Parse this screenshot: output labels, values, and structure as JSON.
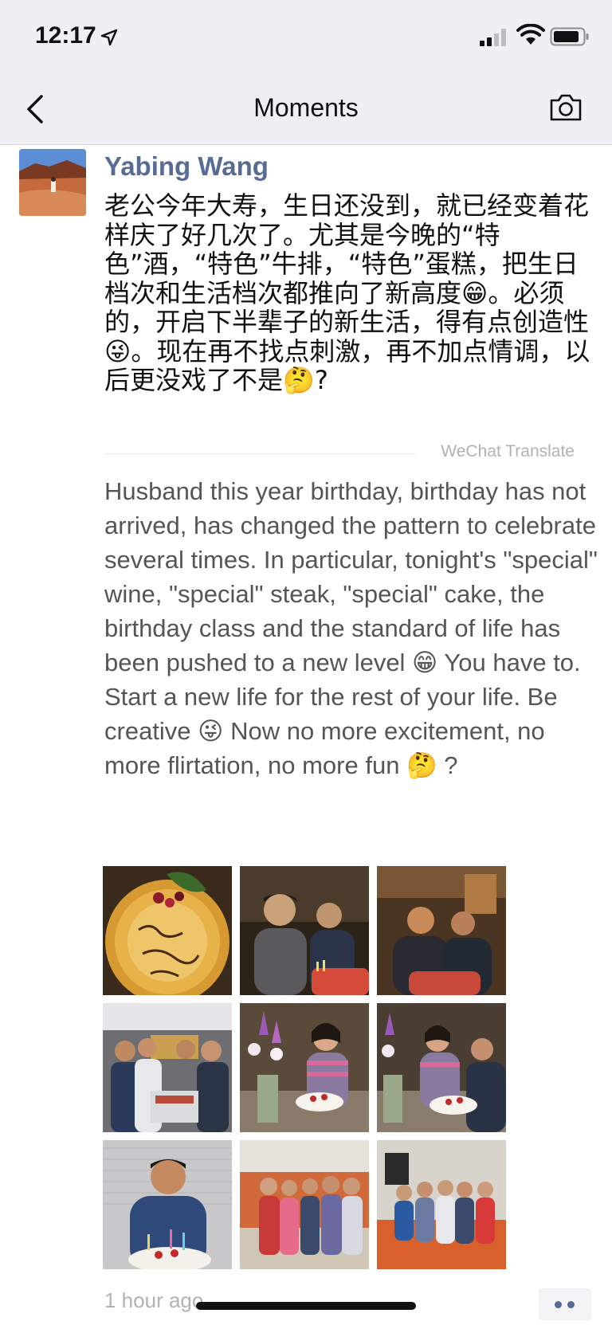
{
  "status_bar": {
    "time": "12:17"
  },
  "nav": {
    "title": "Moments"
  },
  "post": {
    "author": "Yabing Wang",
    "text": "老公今年大寿，生日还没到，就已经变着花样庆了好几次了。尤其是今晚的“特色”酒，“特色”牛排，“特色”蛋糕，把生日档次和生活档次都推向了新高度😁。必须的，开启下半辈子的新生活，得有点创造性😜。现在再不找点刺激，再不加点情调，以后更没戏了不是🤔?",
    "translate_label": "WeChat Translate",
    "translation": "Husband this year birthday, birthday has not arrived, has changed the pattern to celebrate several times. In particular, tonight's \"special\" wine, \"special\" steak, \"special\" cake, the birthday class and the standard of life has been pushed to a new level 😁 You have to. Start a new life for the rest of your life. Be creative 😜 Now no more excitement, no more flirtation, no more fun 🤔 ?",
    "timestamp": "1 hour ago",
    "photos": [
      {
        "name": "photo-birthday-cake",
        "bg": "#3a2a1c",
        "accent": "#e8b24a"
      },
      {
        "name": "photo-two-men-table",
        "bg": "#2b2218",
        "accent": "#c9a27a"
      },
      {
        "name": "photo-two-men-kitchen",
        "bg": "#4a3422",
        "accent": "#c98a4a"
      },
      {
        "name": "photo-group-restaurant",
        "bg": "#6e6e72",
        "accent": "#2a3a5a"
      },
      {
        "name": "photo-woman-flowers",
        "bg": "#5a4a3a",
        "accent": "#b86aa8"
      },
      {
        "name": "photo-couple-cake",
        "bg": "#4a3e32",
        "accent": "#8a5aa0"
      },
      {
        "name": "photo-man-cake",
        "bg": "#c8c8ca",
        "accent": "#2f4a7a"
      },
      {
        "name": "photo-family-standing",
        "bg": "#cfc6b6",
        "accent": "#c03a3a"
      },
      {
        "name": "photo-family-sofa",
        "bg": "#d8d4cc",
        "accent": "#d8602a"
      }
    ]
  },
  "colors": {
    "link_blue": "#576b95",
    "nav_bg": "#efeff4"
  }
}
